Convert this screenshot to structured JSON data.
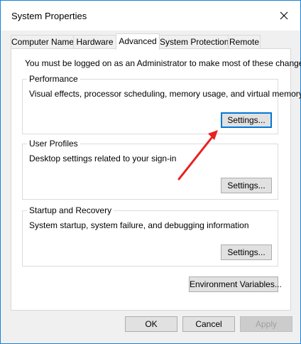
{
  "window": {
    "title": "System Properties",
    "accent_color": "#1883d7",
    "close_icon": "close-icon"
  },
  "tabs": [
    {
      "label": "Computer Name",
      "active": false
    },
    {
      "label": "Hardware",
      "active": false
    },
    {
      "label": "Advanced",
      "active": true
    },
    {
      "label": "System Protection",
      "active": false
    },
    {
      "label": "Remote",
      "active": false
    }
  ],
  "advanced": {
    "intro": "You must be logged on as an Administrator to make most of these changes.",
    "performance": {
      "title": "Performance",
      "description": "Visual effects, processor scheduling, memory usage, and virtual memory",
      "settings_label": "Settings..."
    },
    "user_profiles": {
      "title": "User Profiles",
      "description": "Desktop settings related to your sign-in",
      "settings_label": "Settings..."
    },
    "startup_recovery": {
      "title": "Startup and Recovery",
      "description": "System startup, system failure, and debugging information",
      "settings_label": "Settings..."
    },
    "env_vars_label": "Environment Variables..."
  },
  "footer": {
    "ok_label": "OK",
    "cancel_label": "Cancel",
    "apply_label": "Apply"
  },
  "annotation": {
    "arrow_color": "#e8201e",
    "arrow_icon": "red-arrow-icon"
  }
}
